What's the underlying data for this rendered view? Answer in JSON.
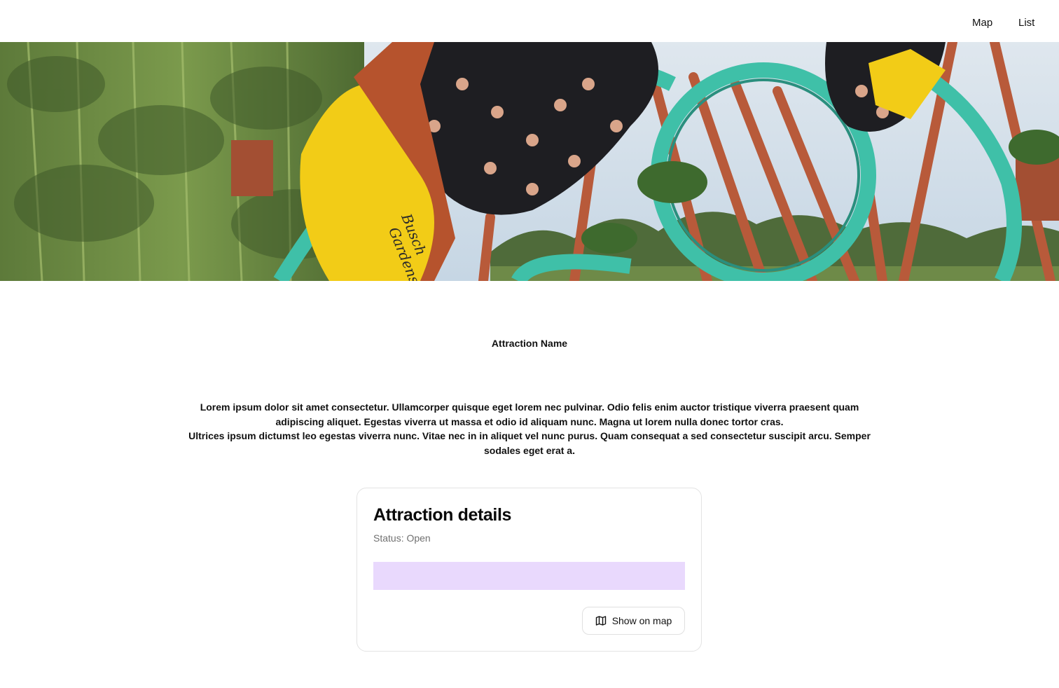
{
  "nav": {
    "map_label": "Map",
    "list_label": "List"
  },
  "hero": {
    "logo_text_line1": "Busch",
    "logo_text_line2": "Gardens"
  },
  "attraction": {
    "name": "Attraction Name",
    "description_p1": "Lorem ipsum dolor sit amet consectetur. Ullamcorper quisque eget lorem nec pulvinar. Odio felis enim auctor tristique viverra praesent quam adipiscing aliquet. Egestas viverra ut massa et odio id aliquam nunc. Magna ut lorem nulla donec tortor cras.",
    "description_p2": "Ultrices ipsum dictumst leo egestas viverra nunc. Vitae nec in in aliquet vel nunc purus. Quam consequat a sed consectetur suscipit arcu. Semper sodales eget erat a."
  },
  "details": {
    "title": "Attraction details",
    "status": "Status: Open",
    "show_on_map_label": "Show on map",
    "show_on_map_icon": "map-icon"
  },
  "colors": {
    "accent_bar": "#e9d9fd",
    "track_teal": "#3fc0a8",
    "supports_red": "#b85a3a",
    "car_yellow": "#f2cc17"
  }
}
